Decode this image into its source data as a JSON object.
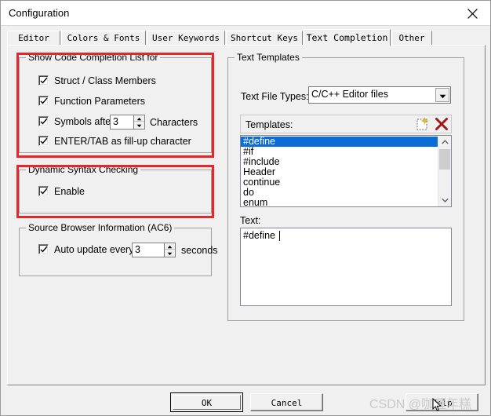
{
  "window": {
    "title": "Configuration",
    "close_icon": "close-icon"
  },
  "tabs": [
    {
      "label": "Editor",
      "active": false
    },
    {
      "label": "Colors & Fonts",
      "active": false
    },
    {
      "label": "User Keywords",
      "active": false
    },
    {
      "label": "Shortcut Keys",
      "active": false
    },
    {
      "label": "Text Completion",
      "active": true
    },
    {
      "label": "Other",
      "active": false
    }
  ],
  "left": {
    "code_completion": {
      "title": "Show Code Completion List for",
      "items": [
        {
          "label": "Struct / Class Members",
          "checked": true
        },
        {
          "label": "Function Parameters",
          "checked": true
        },
        {
          "label": "ENTER/TAB as fill-up character",
          "checked": true
        }
      ],
      "symbols_after": {
        "checked": true,
        "label": "Symbols after",
        "value": "3",
        "suffix": "Characters"
      }
    },
    "dynamic_syntax": {
      "title": "Dynamic Syntax Checking",
      "enable": {
        "label": "Enable",
        "checked": true
      }
    },
    "source_browser": {
      "title": "Source Browser Information (AC6)",
      "auto_update": {
        "checked": true,
        "label": "Auto update every",
        "value": "3",
        "suffix": "seconds"
      }
    }
  },
  "right": {
    "title": "Text Templates",
    "file_types_label": "Text File Types:",
    "file_types_value": "C/C++ Editor files",
    "templates_label": "Templates:",
    "toolbar": [
      {
        "name": "new-template-icon",
        "tooltip": "New"
      },
      {
        "name": "delete-template-icon",
        "tooltip": "Delete"
      }
    ],
    "templates": [
      {
        "label": "#define",
        "selected": true
      },
      {
        "label": "#if",
        "selected": false
      },
      {
        "label": "#include",
        "selected": false
      },
      {
        "label": "Header",
        "selected": false
      },
      {
        "label": "continue",
        "selected": false
      },
      {
        "label": "do",
        "selected": false
      },
      {
        "label": "enum",
        "selected": false
      }
    ],
    "text_label": "Text:",
    "text_value": "#define "
  },
  "buttons": {
    "ok": "OK",
    "cancel": "Cancel",
    "help": "Help"
  },
  "watermark": "CSDN @咖喱年糕",
  "colors": {
    "dialog_bg": "#f0f0f0",
    "annotation_red": "#e8262a",
    "selection_blue": "#0a6cd4",
    "group_border": "#a0a0a0"
  }
}
